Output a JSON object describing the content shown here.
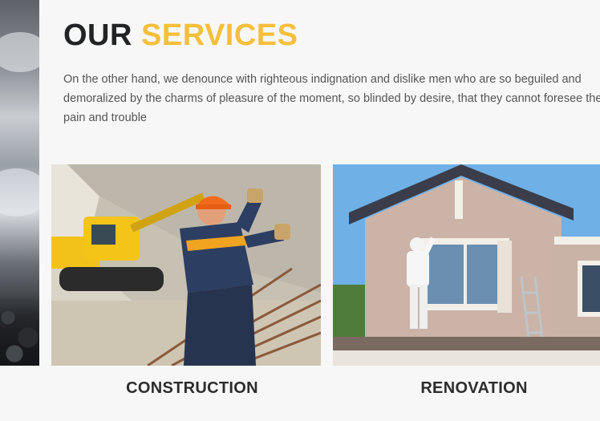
{
  "section": {
    "title_part1": "OUR",
    "title_part2": "SERVICES",
    "intro": "On the other hand, we denounce with righteous indignation and dislike men who are so beguiled and demoralized by the charms of pleasure of the moment, so blinded by desire, that they cannot foresee the pain and trouble"
  },
  "services": [
    {
      "label": "CONSTRUCTION"
    },
    {
      "label": "RENOVATION"
    }
  ],
  "colors": {
    "accent": "#f5bf3c",
    "dark_text": "#222325",
    "body_text": "#555555",
    "background": "#f7f7f7"
  }
}
